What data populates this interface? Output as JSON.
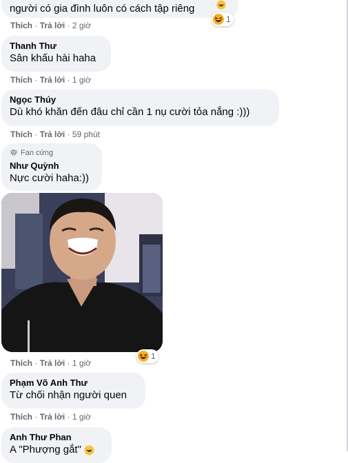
{
  "ui": {
    "like": "Thích",
    "reply": "Trả lời",
    "sep": "·"
  },
  "comments": [
    {
      "text": "người có gia đình luôn có cách tập riêng",
      "time": "2 giờ",
      "reaction_count": "1",
      "reaction_icon": "laughing-emoji-icon"
    },
    {
      "author": "Thanh Thư",
      "text": "Sân khấu hài haha",
      "time": "1 giờ"
    },
    {
      "author": "Ngọc Thúy",
      "text": "Dù khó khăn đến đâu chỉ cần 1 nụ cười tỏa nắng :)))",
      "time": "59 phút"
    },
    {
      "badge": "Fan cứng",
      "author": "Như Quỳnh",
      "text": "Nực cười haha:))",
      "time": "1 giờ",
      "reaction_count": "1",
      "reaction_icon": "laughing-emoji-icon",
      "image": "laughing-man-photo"
    },
    {
      "author": "Phạm Võ Anh Thư",
      "text": "Từ chối nhận người quen",
      "time": "1 giờ"
    },
    {
      "author": "Anh Thư Phan",
      "text": "A \"Phượng gắt\""
    }
  ],
  "colors": {
    "bubble": "#f0f2f5",
    "meta": "#65676b",
    "text": "#050505"
  }
}
